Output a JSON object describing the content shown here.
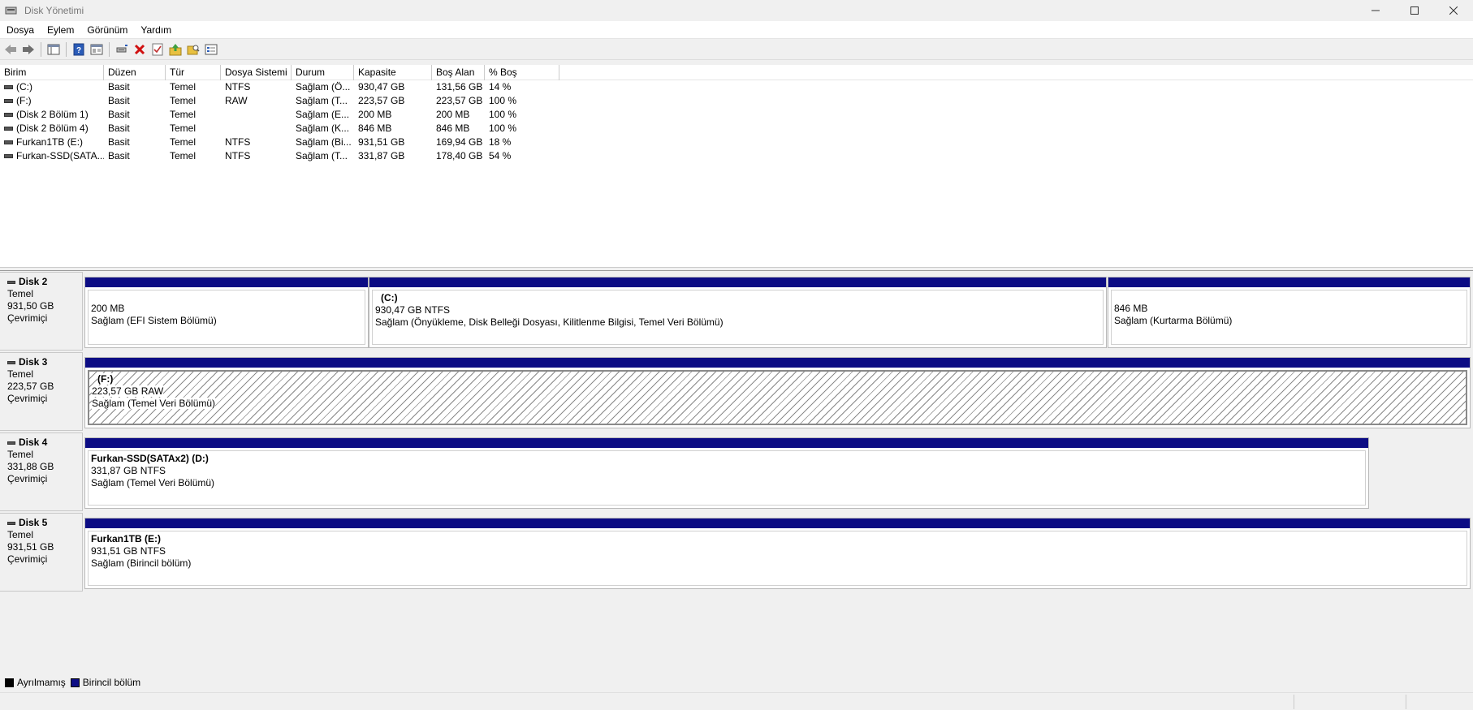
{
  "window": {
    "title": "Disk Yönetimi"
  },
  "menu": [
    "Dosya",
    "Eylem",
    "Görünüm",
    "Yardım"
  ],
  "toolbar_icons": [
    "back-arrow-icon",
    "forward-arrow-icon",
    "show-hide-tree-icon",
    "help-icon",
    "properties-icon",
    "connect-icon",
    "delete-icon",
    "checklist-icon",
    "up-folder-icon",
    "search-folder-icon",
    "console-view-icon"
  ],
  "columns": [
    "Birim",
    "Düzen",
    "Tür",
    "Dosya Sistemi",
    "Durum",
    "Kapasite",
    "Boş Alan",
    "% Boş"
  ],
  "volumes": [
    [
      "(C:)",
      "Basit",
      "Temel",
      "NTFS",
      "Sağlam (Ö...",
      "930,47 GB",
      "131,56 GB",
      "14 %"
    ],
    [
      "(F:)",
      "Basit",
      "Temel",
      "RAW",
      "Sağlam (T...",
      "223,57 GB",
      "223,57 GB",
      "100 %"
    ],
    [
      "(Disk 2 Bölüm 1)",
      "Basit",
      "Temel",
      "",
      "Sağlam (E...",
      "200 MB",
      "200 MB",
      "100 %"
    ],
    [
      "(Disk 2 Bölüm 4)",
      "Basit",
      "Temel",
      "",
      "Sağlam (K...",
      "846 MB",
      "846 MB",
      "100 %"
    ],
    [
      "Furkan1TB (E:)",
      "Basit",
      "Temel",
      "NTFS",
      "Sağlam (Bi...",
      "931,51 GB",
      "169,94 GB",
      "18 %"
    ],
    [
      "Furkan-SSD(SATA...",
      "Basit",
      "Temel",
      "NTFS",
      "Sağlam (T...",
      "331,87 GB",
      "178,40 GB",
      "54 %"
    ]
  ],
  "disks": [
    {
      "name": "Disk 2",
      "type": "Temel",
      "size": "931,50 GB",
      "status": "Çevrimiçi",
      "partitions": [
        {
          "label": "",
          "size": "200 MB",
          "status": "Sağlam (EFI Sistem Bölümü)"
        },
        {
          "label": "(C:)",
          "size": "930,47 GB NTFS",
          "status": "Sağlam (Önyükleme, Disk Belleği Dosyası, Kilitlenme Bilgisi, Temel Veri Bölümü)"
        },
        {
          "label": "",
          "size": "846 MB",
          "status": "Sağlam (Kurtarma Bölümü)"
        }
      ]
    },
    {
      "name": "Disk 3",
      "type": "Temel",
      "size": "223,57 GB",
      "status": "Çevrimiçi",
      "partitions": [
        {
          "label": "(F:)",
          "size": "223,57 GB RAW",
          "status": "Sağlam (Temel Veri Bölümü)"
        }
      ]
    },
    {
      "name": "Disk 4",
      "type": "Temel",
      "size": "331,88 GB",
      "status": "Çevrimiçi",
      "partitions": [
        {
          "label": "Furkan-SSD(SATAx2)  (D:)",
          "size": "331,87 GB NTFS",
          "status": "Sağlam (Temel Veri Bölümü)"
        }
      ]
    },
    {
      "name": "Disk 5",
      "type": "Temel",
      "size": "931,51 GB",
      "status": "Çevrimiçi",
      "partitions": [
        {
          "label": "Furkan1TB  (E:)",
          "size": "931,51 GB NTFS",
          "status": "Sağlam (Birincil bölüm)"
        }
      ]
    }
  ],
  "legend": [
    {
      "label": "Ayrılmamış",
      "color": "#000000"
    },
    {
      "label": "Birincil bölüm",
      "color": "#0c0c84"
    }
  ]
}
